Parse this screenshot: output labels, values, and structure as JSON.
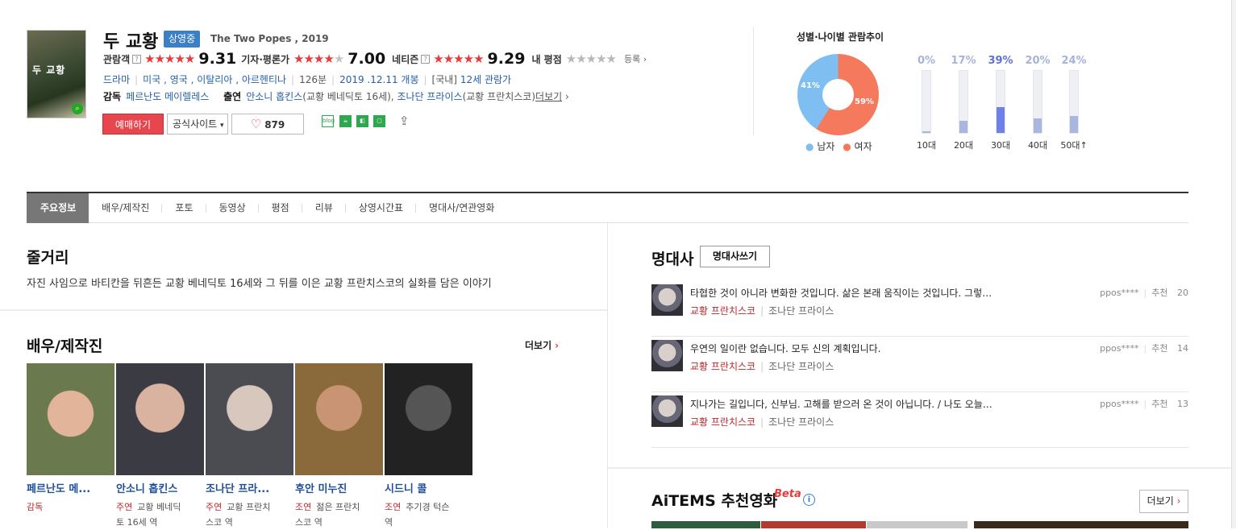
{
  "movie": {
    "title": "두 교황",
    "status_badge": "상영중",
    "english_title": "The Two Popes , 2019",
    "poster_text": "두 교황"
  },
  "ratings": {
    "audience_label": "관람객",
    "audience_score": "9.31",
    "critic_label": "기자·평론가",
    "critic_score": "7.00",
    "netizen_label": "네티즌",
    "netizen_score": "9.29",
    "my_label": "내 평점",
    "register_label": "등록",
    "help_mark": "?"
  },
  "info": {
    "genre": "드라마",
    "countries": "미국 , 영국 , 이탈리아 , 아르헨티나",
    "runtime": "126분",
    "release": "2019 .12.11 개봉",
    "rating_prefix": "[국내]",
    "rating": "12세 관람가",
    "director_label": "감독",
    "director": "페르난도 메이렐레스",
    "cast_label": "출연",
    "cast1": "안소니 홉킨스",
    "cast1_role": "(교황 베네딕토 16세),",
    "cast2": "조나단 프라이스",
    "cast2_role": "(교황 프란치스코)",
    "more": "더보기"
  },
  "buttons": {
    "book": "예매하기",
    "official_site": "공식사이트",
    "likes": "879",
    "blog": "blog"
  },
  "demographics": {
    "title": "성별·나이별 관람추이",
    "male_pct": "41%",
    "female_pct": "59%",
    "male_label": "남자",
    "female_label": "여자",
    "ages": [
      {
        "label": "10대",
        "pct": "0%",
        "value": 0.02
      },
      {
        "label": "20대",
        "pct": "17%",
        "value": 0.2
      },
      {
        "label": "30대",
        "pct": "39%",
        "value": 0.42
      },
      {
        "label": "40대",
        "pct": "20%",
        "value": 0.23
      },
      {
        "label": "50대↑",
        "pct": "24%",
        "value": 0.27
      }
    ]
  },
  "tabs": [
    "주요정보",
    "배우/제작진",
    "포토",
    "동영상",
    "평점",
    "리뷰",
    "상영시간표",
    "명대사/연관영화"
  ],
  "synopsis": {
    "title": "줄거리",
    "text": "자진 사임으로 바티칸을 뒤흔든 교황 베네딕토 16세와 그 뒤를 이은 교황 프란치스코의 실화를 담은 이야기"
  },
  "cast_section": {
    "title": "배우/제작진",
    "more": "더보기",
    "people": [
      {
        "name": "페르난도 메...",
        "role": "감독",
        "desc": ""
      },
      {
        "name": "안소니 홉킨스",
        "role": "주연",
        "desc": "교황 베네딕",
        "desc2": "토 16세 역"
      },
      {
        "name": "조나단 프라...",
        "role": "주연",
        "desc": "교황 프란치",
        "desc2": "스코 역"
      },
      {
        "name": "후안 미누진",
        "role": "조연",
        "desc": "젊은 프란치",
        "desc2": "스코 역"
      },
      {
        "name": "시드니 콜",
        "role": "조연",
        "desc": "추기경 턱슨",
        "desc2": "역"
      }
    ]
  },
  "quotes": {
    "title": "명대사",
    "write_button": "명대사쓰기",
    "items": [
      {
        "text": "타협한 것이 아니라 변화한 것입니다. 삶은 본래 움직이는 것입니다. 그렇…",
        "character": "교황 프란치스코",
        "actor": "조나단 프라이스",
        "user": "ppos****",
        "rec_label": "추천",
        "rec": "20"
      },
      {
        "text": "우연의 일이란 없습니다. 모두 신의 계획입니다.",
        "character": "교황 프란치스코",
        "actor": "조나단 프라이스",
        "user": "ppos****",
        "rec_label": "추천",
        "rec": "14"
      },
      {
        "text": "지나가는 길입니다, 신부님. 고해를 받으러 온 것이 아닙니다. / 나도 오늘…",
        "character": "교황 프란치스코",
        "actor": "조나단 프라이스",
        "user": "ppos****",
        "rec_label": "추천",
        "rec": "13"
      }
    ]
  },
  "aitems": {
    "title": "AiTEMS 추천영화",
    "beta": "Beta",
    "more": "더보기"
  }
}
